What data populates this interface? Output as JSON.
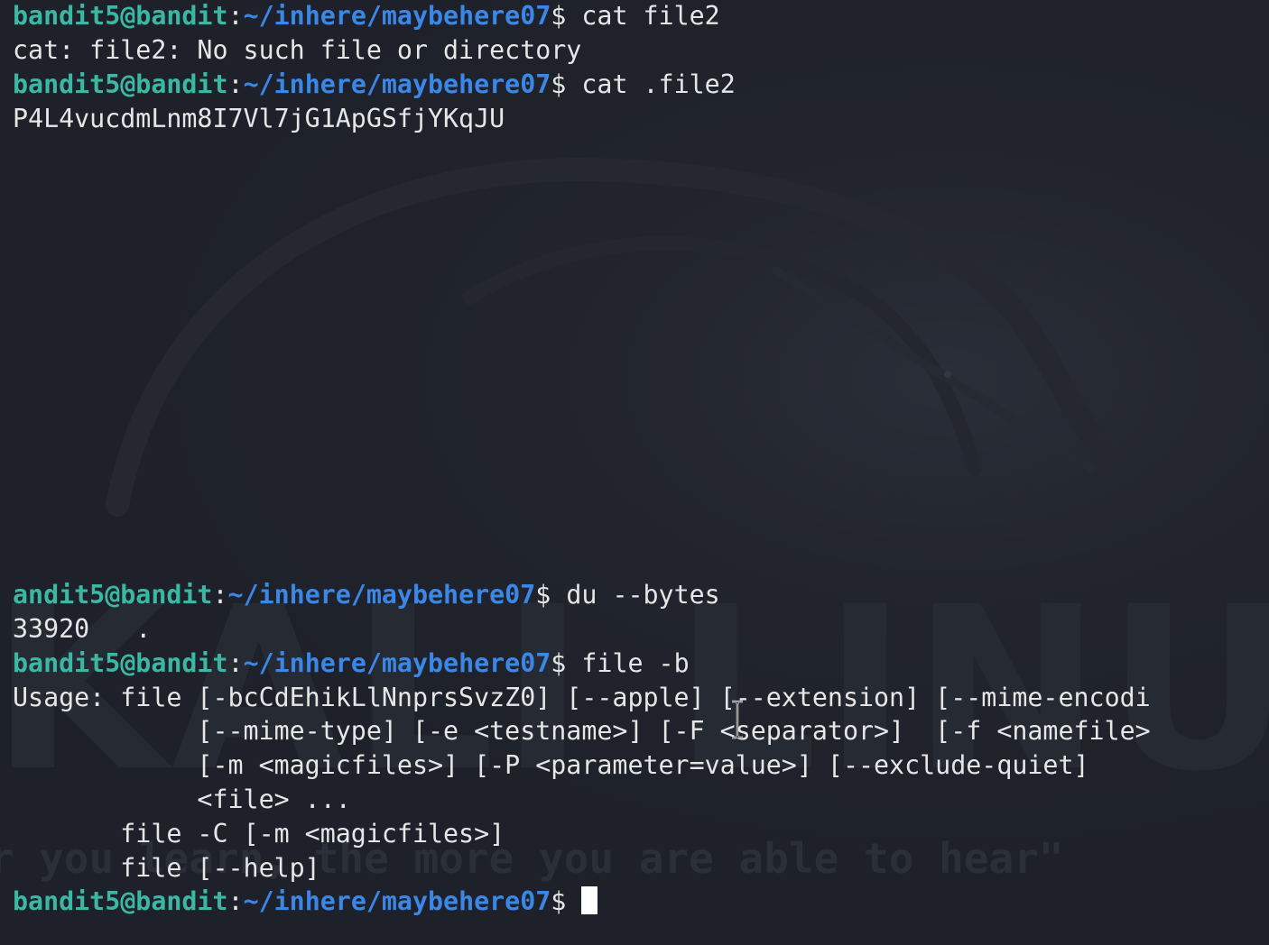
{
  "terminal": {
    "user_host": "bandit5@bandit",
    "user_host_truncated": "andit5@bandit",
    "colon": ":",
    "path": "~/inhere/maybehere07",
    "prompt_symbol": "$ ",
    "lines": [
      {
        "type": "prompt",
        "command": "cat file2"
      },
      {
        "type": "output",
        "text": "cat: file2: No such file or directory"
      },
      {
        "type": "prompt",
        "command": "cat .file2"
      },
      {
        "type": "output",
        "text": "P4L4vucdmLnm8I7Vl7jG1ApGSfjYKqJU"
      },
      {
        "type": "prompt_truncated",
        "command": "du --bytes"
      },
      {
        "type": "output",
        "text": "33920   ."
      },
      {
        "type": "prompt",
        "command": "file -b"
      },
      {
        "type": "output",
        "text": "Usage: file [-bcCdEhikLlNnprsSvzZ0] [--apple] [--extension] [--mime-encodi"
      },
      {
        "type": "output",
        "text": "            [--mime-type] [-e <testname>] [-F <separator>]  [-f <namefile>"
      },
      {
        "type": "output",
        "text": "            [-m <magicfiles>] [-P <parameter=value>] [--exclude-quiet]"
      },
      {
        "type": "output",
        "text": "            <file> ..."
      },
      {
        "type": "output",
        "text": "       file -C [-m <magicfiles>]"
      },
      {
        "type": "output",
        "text": "       file [--help]"
      },
      {
        "type": "prompt_active",
        "command": ""
      }
    ]
  },
  "wallpaper": {
    "brand": "KALI LINUX",
    "quote": "er you learn, the more you are able to hear\""
  },
  "colors": {
    "background": "#1e2129",
    "user_host": "#3bb8a4",
    "path": "#3a87e8",
    "text": "#e6e6e6",
    "cursor": "#ffffff"
  }
}
